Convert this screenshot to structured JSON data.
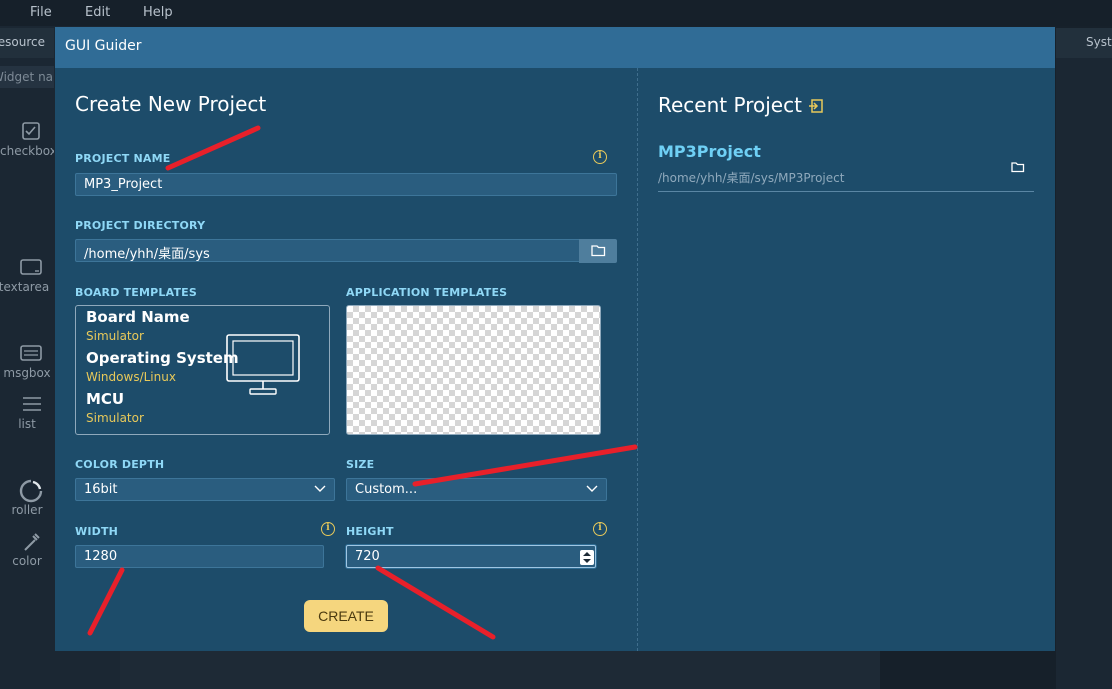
{
  "menubar": {
    "file": "File",
    "edit": "Edit",
    "help": "Help"
  },
  "background": {
    "resource_tab": "Resource",
    "widget_search": "Widget name",
    "system_tab": "System",
    "widgets": [
      {
        "label": "checkbox",
        "icon": "checkbox-icon"
      },
      {
        "label": "textarea",
        "icon": "textarea-icon"
      },
      {
        "label": "msgbox",
        "icon": "msgbox-icon"
      },
      {
        "label": "list",
        "icon": "list-icon"
      },
      {
        "label": "roller",
        "icon": "roller-icon"
      },
      {
        "label": "color",
        "icon": "color-picker-icon"
      }
    ]
  },
  "dialog": {
    "title": "GUI Guider",
    "create": {
      "heading": "Create New Project",
      "project_name_label": "PROJECT NAME",
      "project_name_value": "MP3_Project",
      "project_directory_label": "PROJECT DIRECTORY",
      "project_directory_value": "/home/yhh/桌面/sys",
      "board_templates_label": "BOARD TEMPLATES",
      "application_templates_label": "APPLICATION TEMPLATES",
      "board": {
        "board_name_title": "Board Name",
        "board_name_value": "Simulator",
        "os_title": "Operating System",
        "os_value": "Windows/Linux",
        "mcu_title": "MCU",
        "mcu_value": "Simulator"
      },
      "color_depth_label": "COLOR DEPTH",
      "color_depth_value": "16bit",
      "size_label": "SIZE",
      "size_value": "Custom...",
      "width_label": "WIDTH",
      "width_value": "1280",
      "height_label": "HEIGHT",
      "height_value": "720",
      "create_button": "CREATE"
    },
    "recent": {
      "heading": "Recent Project",
      "items": [
        {
          "name": "MP3Project",
          "path": "/home/yhh/桌面/sys/MP3Project"
        }
      ]
    }
  },
  "colors": {
    "dialog_bg": "#1d4c6a",
    "titlebar_bg": "#306c96",
    "label_color": "#8fd8f6",
    "accent_yellow": "#e8c95a",
    "create_button_bg": "#f5d67e",
    "annotation_red": "#e8202a"
  }
}
